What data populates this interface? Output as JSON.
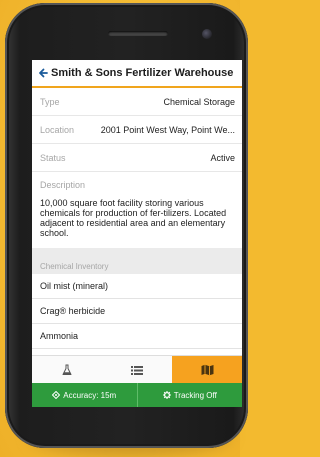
{
  "header": {
    "title": "Smith & Sons Fertilizer Warehouse"
  },
  "fields": {
    "type": {
      "label": "Type",
      "value": "Chemical Storage"
    },
    "location": {
      "label": "Location",
      "value": "2001 Point West Way, Point We..."
    },
    "status": {
      "label": "Status",
      "value": "Active"
    }
  },
  "description": {
    "label": "Description",
    "text": "10,000 square foot facility storing various chemicals for production of fer-tilizers. Located adjacent to residential area and an elementary school."
  },
  "inventory": {
    "label": "Chemical Inventory",
    "items": [
      "Oil mist (mineral)",
      "Crag® herbicide",
      "Ammonia"
    ]
  },
  "tabs": {
    "icons": [
      "flask-icon",
      "list-icon",
      "map-icon"
    ],
    "active": 2
  },
  "statusbar": {
    "accuracy": "Accuracy: 15m",
    "tracking": "Tracking Off"
  },
  "colors": {
    "accent": "#f6a21f",
    "statusbar": "#2e9b3d",
    "background": "#f3ba2f"
  }
}
